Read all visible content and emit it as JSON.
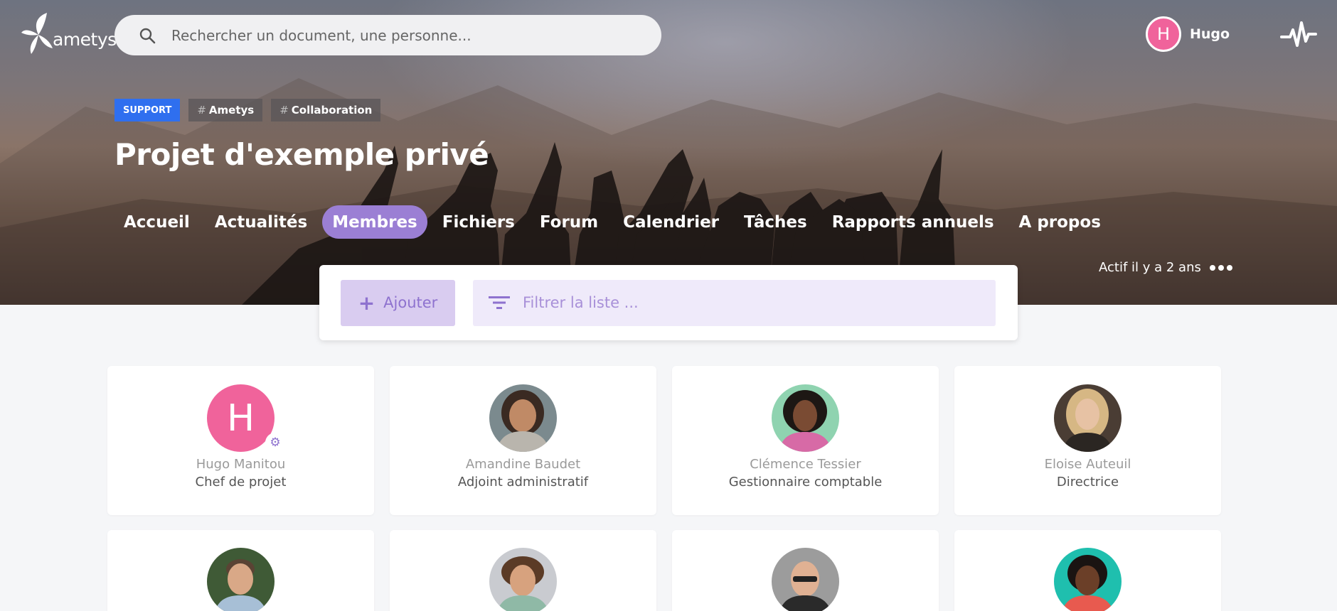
{
  "app": {
    "logo_text": "ametys"
  },
  "search": {
    "placeholder": "Rechercher un document, une personne..."
  },
  "user": {
    "initial": "H",
    "name": "Hugo"
  },
  "project": {
    "tags": {
      "support": "SUPPORT",
      "tag1": "Ametys",
      "tag2": "Collaboration",
      "hash": "#"
    },
    "title": "Projet d'exemple privé",
    "status": "Actif il y a 2 ans"
  },
  "nav": {
    "items": [
      {
        "label": "Accueil"
      },
      {
        "label": "Actualités"
      },
      {
        "label": "Membres",
        "active": true
      },
      {
        "label": "Fichiers"
      },
      {
        "label": "Forum"
      },
      {
        "label": "Calendrier"
      },
      {
        "label": "Tâches"
      },
      {
        "label": "Rapports annuels"
      },
      {
        "label": "A propos"
      }
    ]
  },
  "toolbar": {
    "add_label": "Ajouter",
    "filter_placeholder": "Filtrer la liste ..."
  },
  "members": [
    {
      "name": "Hugo Manitou",
      "role": "Chef de projet",
      "initial": "H"
    },
    {
      "name": "Amandine Baudet",
      "role": "Adjoint administratif"
    },
    {
      "name": "Clémence Tessier",
      "role": "Gestionnaire comptable"
    },
    {
      "name": "Eloise Auteuil",
      "role": "Directrice"
    }
  ],
  "colors": {
    "accent": "#9b7fd4",
    "support_tag": "#2f6fef",
    "avatar_pink": "#f0639b"
  },
  "icons": {
    "search": "search-icon",
    "activity": "pulse-icon",
    "filter": "filter-icon",
    "add": "plus-icon",
    "manager": "gear-icon",
    "more": "more-dots-icon"
  }
}
